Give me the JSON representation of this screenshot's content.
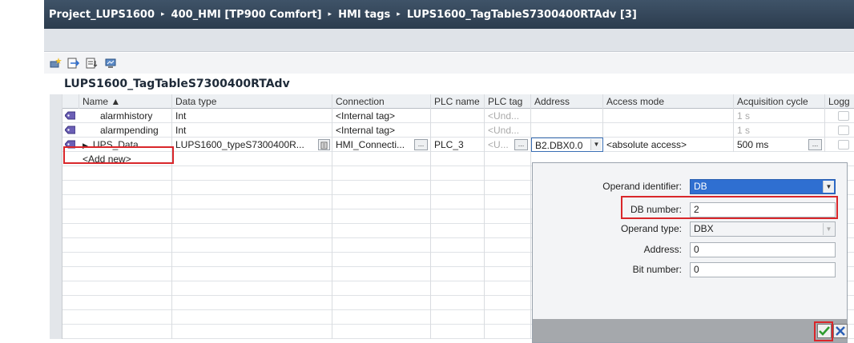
{
  "breadcrumb": {
    "items": [
      "Project_LUPS1600",
      "400_HMI [TP900 Comfort]",
      "HMI tags",
      "LUPS1600_TagTableS7300400RTAdv [3]"
    ],
    "separator": "▸"
  },
  "toolbar": {
    "icons": [
      "add-tag-icon",
      "insert-row-icon",
      "export-icon",
      "monitor-icon"
    ]
  },
  "table": {
    "title": "LUPS1600_TagTableS7300400RTAdv",
    "columns": [
      "Name ▲",
      "Data type",
      "Connection",
      "PLC name",
      "PLC tag",
      "Address",
      "Access mode",
      "Acquisition cycle",
      "Logg"
    ],
    "rows": [
      {
        "name": "alarmhistory",
        "data_type": "Int",
        "connection": "<Internal tag>",
        "plc_name": "",
        "plc_tag": "<Und...",
        "address": "",
        "access_mode": "",
        "acq_cycle": "1 s"
      },
      {
        "name": "alarmpending",
        "data_type": "Int",
        "connection": "<Internal tag>",
        "plc_name": "",
        "plc_tag": "<Und...",
        "address": "",
        "access_mode": "",
        "acq_cycle": "1 s"
      },
      {
        "name": "UPS_Data",
        "data_type": "LUPS1600_typeS7300400R...",
        "connection": "HMI_Connecti...",
        "plc_name": "PLC_3",
        "plc_tag": "<U...",
        "address": "B2.DBX0.0",
        "access_mode": "<absolute access>",
        "acq_cycle": "500 ms"
      }
    ],
    "add_new": "<Add new>"
  },
  "popup": {
    "operand_identifier_label": "Operand identifier:",
    "operand_identifier_value": "DB",
    "db_number_label": "DB number:",
    "db_number_value": "2",
    "operand_type_label": "Operand type:",
    "operand_type_value": "DBX",
    "address_label": "Address:",
    "address_value": "0",
    "bit_number_label": "Bit number:",
    "bit_number_value": "0"
  },
  "colors": {
    "highlight": "#d9262a",
    "title_bar": "#34475b",
    "selection": "#2f6fd1",
    "ok_green": "#2e9b2e",
    "cancel_blue": "#2b5fb5"
  }
}
